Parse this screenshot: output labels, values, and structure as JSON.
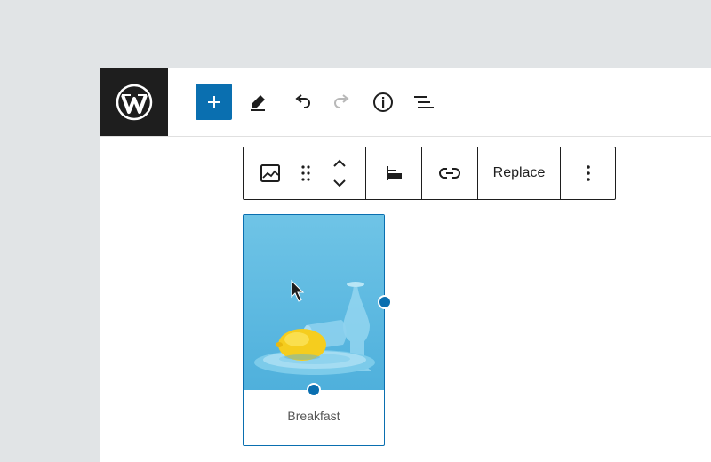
{
  "header": {
    "logo_icon": "wordpress-logo-icon",
    "tools": [
      {
        "name": "add-block",
        "icon": "plus-icon"
      },
      {
        "name": "edit",
        "icon": "pencil-icon"
      },
      {
        "name": "undo",
        "icon": "undo-icon"
      },
      {
        "name": "redo",
        "icon": "redo-icon"
      },
      {
        "name": "details",
        "icon": "info-icon"
      },
      {
        "name": "list-view",
        "icon": "list-view-icon"
      }
    ]
  },
  "block_toolbar": {
    "block_type_icon": "image-icon",
    "drag_icon": "drag-handle-icon",
    "move_icons": [
      "chevron-up-icon",
      "chevron-down-icon"
    ],
    "align_icon": "align-left-icon",
    "link_icon": "link-icon",
    "replace_label": "Replace",
    "more_icon": "more-vertical-icon"
  },
  "image_block": {
    "caption": "Breakfast"
  },
  "colors": {
    "accent": "#0a6fb0",
    "dark": "#1e1e1e",
    "canvas_bg": "#e1e4e6"
  }
}
